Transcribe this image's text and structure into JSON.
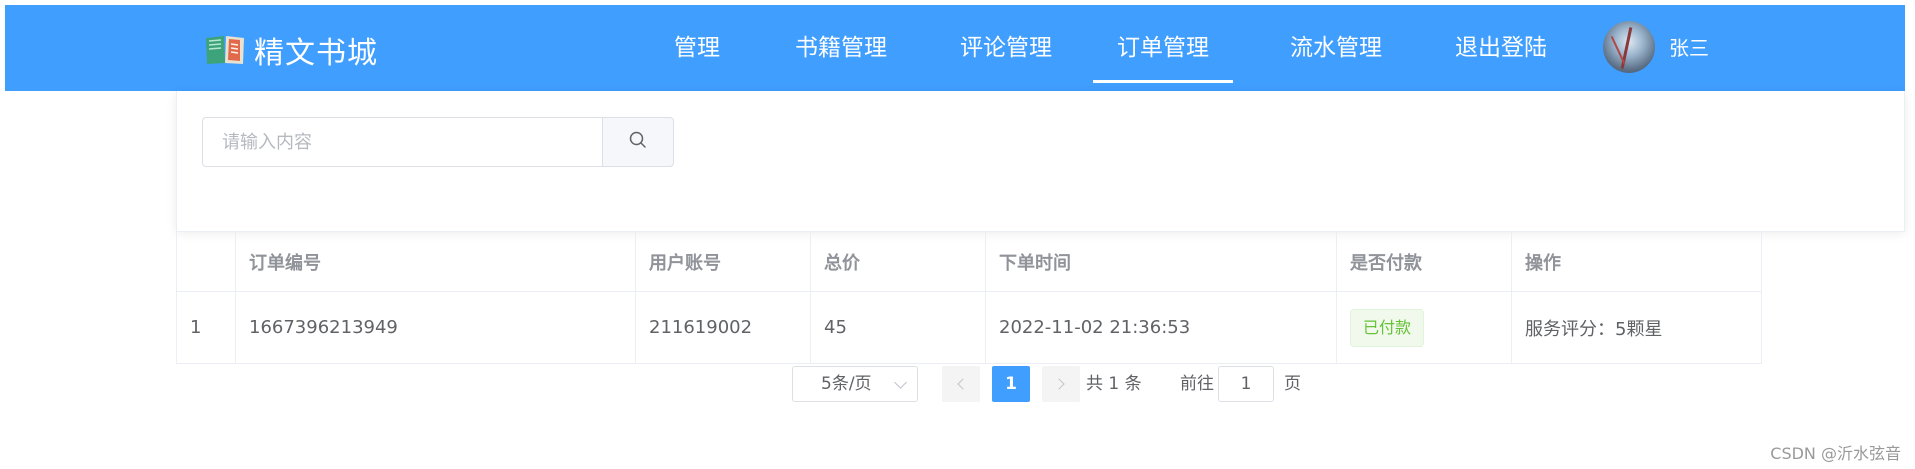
{
  "brand": {
    "title": "精文书城",
    "icon": "book-icon"
  },
  "nav": {
    "items": [
      {
        "label": "管理"
      },
      {
        "label": "书籍管理"
      },
      {
        "label": "评论管理"
      },
      {
        "label": "订单管理",
        "active": true
      },
      {
        "label": "流水管理"
      },
      {
        "label": "退出登陆"
      }
    ],
    "user": {
      "name": "张三",
      "avatar": "avatar-image"
    }
  },
  "search": {
    "placeholder": "请输入内容",
    "value": "",
    "icon": "search-icon"
  },
  "table": {
    "columns": [
      "",
      "订单编号",
      "用户账号",
      "总价",
      "下单时间",
      "是否付款",
      "操作"
    ],
    "rows": [
      {
        "index": "1",
        "order_no": "1667396213949",
        "account": "211619002",
        "total": "45",
        "time": "2022-11-02 21:36:53",
        "paid": "已付款",
        "action": "服务评分：5颗星"
      }
    ]
  },
  "pagination": {
    "page_size": "5条/页",
    "current_page": "1",
    "total_text": "共 1 条",
    "goto_prefix": "前往",
    "goto_value": "1",
    "goto_suffix": "页"
  },
  "watermark": "CSDN @沂水弦音",
  "colors": {
    "primary": "#409eff",
    "success": "#67c23a",
    "text": "#606266",
    "muted": "#909399"
  }
}
